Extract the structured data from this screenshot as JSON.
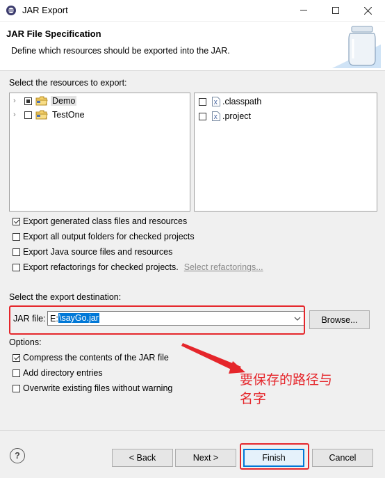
{
  "window": {
    "title": "JAR Export",
    "controls": [
      "minimize-icon",
      "maximize-icon",
      "close-icon"
    ]
  },
  "header": {
    "title": "JAR File Specification",
    "description": "Define which resources should be exported into the JAR."
  },
  "resources": {
    "label": "Select the resources to export:",
    "projects": [
      {
        "label": "Demo",
        "state": "partial",
        "expanded": false
      },
      {
        "label": "TestOne",
        "state": "unchecked",
        "expanded": false
      }
    ],
    "files": [
      {
        "label": ".classpath",
        "checked": false
      },
      {
        "label": ".project",
        "checked": false
      }
    ]
  },
  "export_options": [
    {
      "label": "Export generated class files and resources",
      "checked": true
    },
    {
      "label": "Export all output folders for checked projects",
      "checked": false
    },
    {
      "label": "Export Java source files and resources",
      "checked": false
    },
    {
      "label": "Export refactorings for checked projects.",
      "checked": false,
      "link": "Select refactorings..."
    }
  ],
  "destination": {
    "label": "Select the export destination:",
    "field_label": "JAR file:",
    "value_prefix": "E:",
    "value_selected": "\\sayGo.jar",
    "browse_label": "Browse..."
  },
  "options": {
    "label": "Options:",
    "items": [
      {
        "label": "Compress the contents of the JAR file",
        "checked": true
      },
      {
        "label": "Add directory entries",
        "checked": false
      },
      {
        "label": "Overwrite existing files without warning",
        "checked": false
      }
    ]
  },
  "annotation": {
    "text_line1": "要保存的路径与",
    "text_line2": "名字",
    "color": "#e5262b"
  },
  "buttons": {
    "help": "?",
    "back": "< Back",
    "next": "Next >",
    "finish": "Finish",
    "cancel": "Cancel"
  }
}
